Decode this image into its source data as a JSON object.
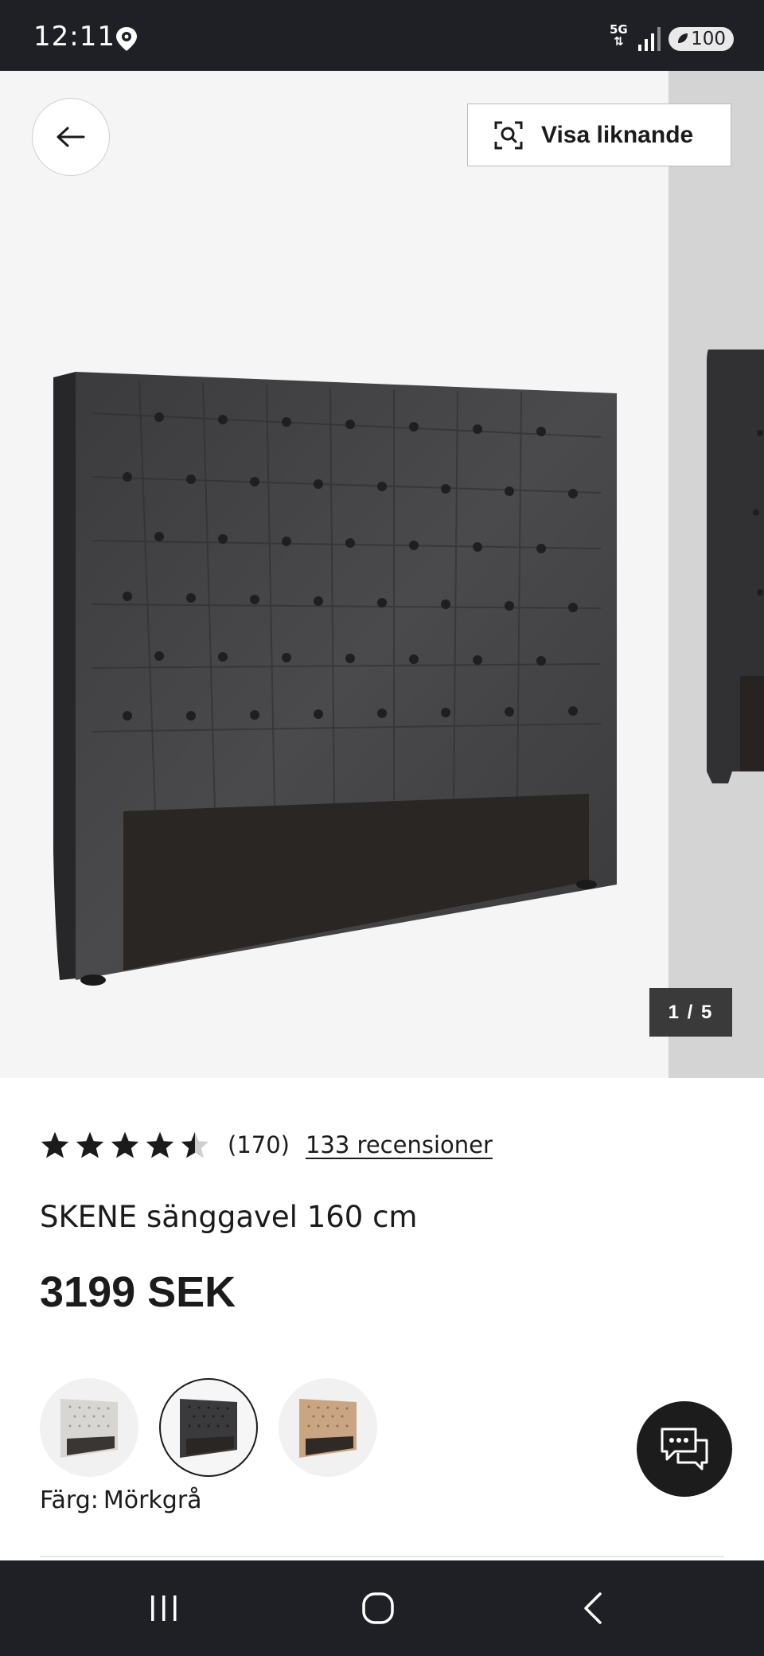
{
  "status_bar": {
    "time": "12:11",
    "network": "5G",
    "battery": "100",
    "icons": [
      "location-pin-icon",
      "signal-icon",
      "battery-icon"
    ]
  },
  "gallery": {
    "similar_label": "Visa liknande",
    "counter": "1 / 5",
    "current_image": 1,
    "total_images": 5,
    "icons": [
      "arrow-left-icon",
      "visual-search-icon"
    ]
  },
  "product": {
    "rating_stars": 4.5,
    "rating_count": "(170)",
    "reviews_link": "133 recensioner",
    "title": "SKENE sänggavel 160 cm",
    "price": "3199 SEK",
    "color_label": "Färg:",
    "color_value": "Mörkgrå",
    "swatches": [
      {
        "color": "#d8d6d3",
        "selected": false
      },
      {
        "color": "#3a3a3c",
        "selected": true
      },
      {
        "color": "#c9a584",
        "selected": false
      }
    ]
  },
  "colors": {
    "status_bar_bg": "#1f2026",
    "gallery_bg": "#f5f5f5",
    "text": "#1b1b1b",
    "counter_bg": "#3a3a3a",
    "chat_bg": "#1c1c1c"
  },
  "chat": {
    "icon": "chat-bubbles-icon"
  },
  "nav_bar": {
    "icons": [
      "recent-apps-icon",
      "home-icon",
      "back-icon"
    ]
  }
}
